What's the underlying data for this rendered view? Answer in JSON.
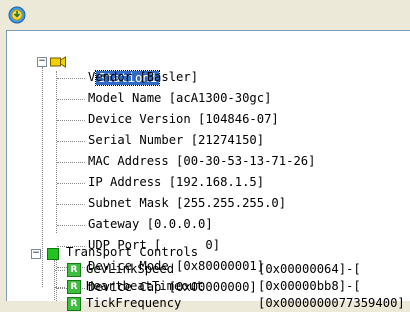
{
  "app": {
    "icon": "app-icon"
  },
  "tree": {
    "root": {
      "label": "Station1",
      "expander": "−",
      "icon": "camera-icon"
    },
    "device_info": [
      {
        "label": "Vendor [Basler]"
      },
      {
        "label": "Model Name [acA1300-30gc]"
      },
      {
        "label": "Device Version [104846-07]"
      },
      {
        "label": "Serial Number [21274150]"
      },
      {
        "label": "MAC Address [00-30-53-13-71-26]"
      },
      {
        "label": "IP Address [192.168.1.5]"
      },
      {
        "label": "Subnet Mask [255.255.255.0]"
      },
      {
        "label": "Gateway [0.0.0.0]"
      },
      {
        "label": "UDP Port [      0]"
      },
      {
        "label": "Device Mode [0x80000001]"
      },
      {
        "label": "Device Cap [0x00000000]"
      }
    ],
    "transport": {
      "label": "Transport Controls",
      "expander": "−",
      "items": [
        {
          "icon_letter": "R",
          "label": "GevLinkSpeed",
          "value": "[0x00000064]-["
        },
        {
          "icon_letter": "R",
          "label": "HeartbeatTimeout",
          "value": "[0x00000bb8]-["
        },
        {
          "icon_letter": "R",
          "label": "TickFrequency",
          "value": "[0x0000000077359400]"
        }
      ]
    }
  }
}
